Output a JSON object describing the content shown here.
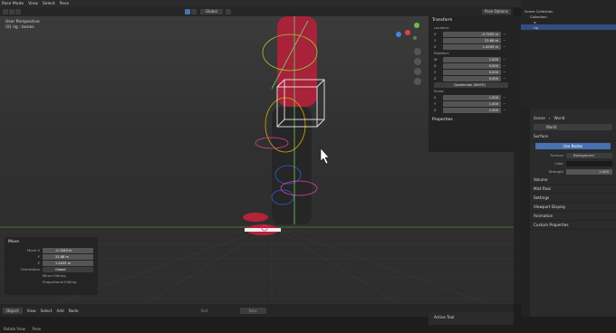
{
  "topbar": {
    "mode": "Pose Mode",
    "menus": [
      "View",
      "Select",
      "Pose"
    ]
  },
  "header": {
    "orientation": "Global",
    "pose_options": "Pose Options"
  },
  "viewport": {
    "perspective": "User Perspective",
    "object": "(0) rig : bones"
  },
  "npanel": {
    "title": "Transform",
    "location_label": "Location:",
    "location": [
      {
        "axis": "X",
        "value": "-0.7445 m"
      },
      {
        "axis": "Y",
        "value": "22.88 m"
      },
      {
        "axis": "Z",
        "value": "1.4035 m"
      }
    ],
    "rotation_label": "Rotation:",
    "rotation": [
      {
        "axis": "W",
        "value": "1.000"
      },
      {
        "axis": "X",
        "value": "0.000"
      },
      {
        "axis": "Y",
        "value": "0.000"
      },
      {
        "axis": "Z",
        "value": "0.000"
      }
    ],
    "rotation_mode": "Quaternion (WXYZ)",
    "scale_label": "Scale:",
    "scale": [
      {
        "axis": "X",
        "value": "1.000"
      },
      {
        "axis": "Y",
        "value": "1.000"
      },
      {
        "axis": "Z",
        "value": "1.000"
      }
    ],
    "properties": "Properties"
  },
  "outliner": {
    "items": [
      "Scene Collection",
      "Collection",
      "rig"
    ]
  },
  "properties": {
    "breadcrumb_scene": "Scene",
    "breadcrumb_world": "World",
    "world_name": "World",
    "surface": "Surface",
    "use_nodes": "Use Nodes",
    "surface_label": "Surface",
    "surface_value": "Background",
    "color_label": "Color",
    "strength_label": "Strength",
    "strength_value": "1.000",
    "sections": [
      "Volume",
      "Mist Pass",
      "Settings",
      "Viewport Display",
      "Animation",
      "Custom Properties"
    ]
  },
  "operator": {
    "title": "Move",
    "move_x_label": "Move X",
    "move_x": "-0.7445 m",
    "y_label": "Y",
    "y": "22.88 m",
    "z_label": "Z",
    "z": "1.4035 m",
    "orientation_label": "Orientation",
    "orientation": "Global",
    "mirror": "Mirror Editing",
    "proportional": "Proportional Editing"
  },
  "bottom": {
    "mode": "Object",
    "menus": [
      "View",
      "Select",
      "Add",
      "Node"
    ],
    "slot": "Slot",
    "new": "New"
  },
  "tile": {
    "title": "Active Tool"
  },
  "status": {
    "items": [
      "Rotate View",
      "Pose"
    ]
  }
}
